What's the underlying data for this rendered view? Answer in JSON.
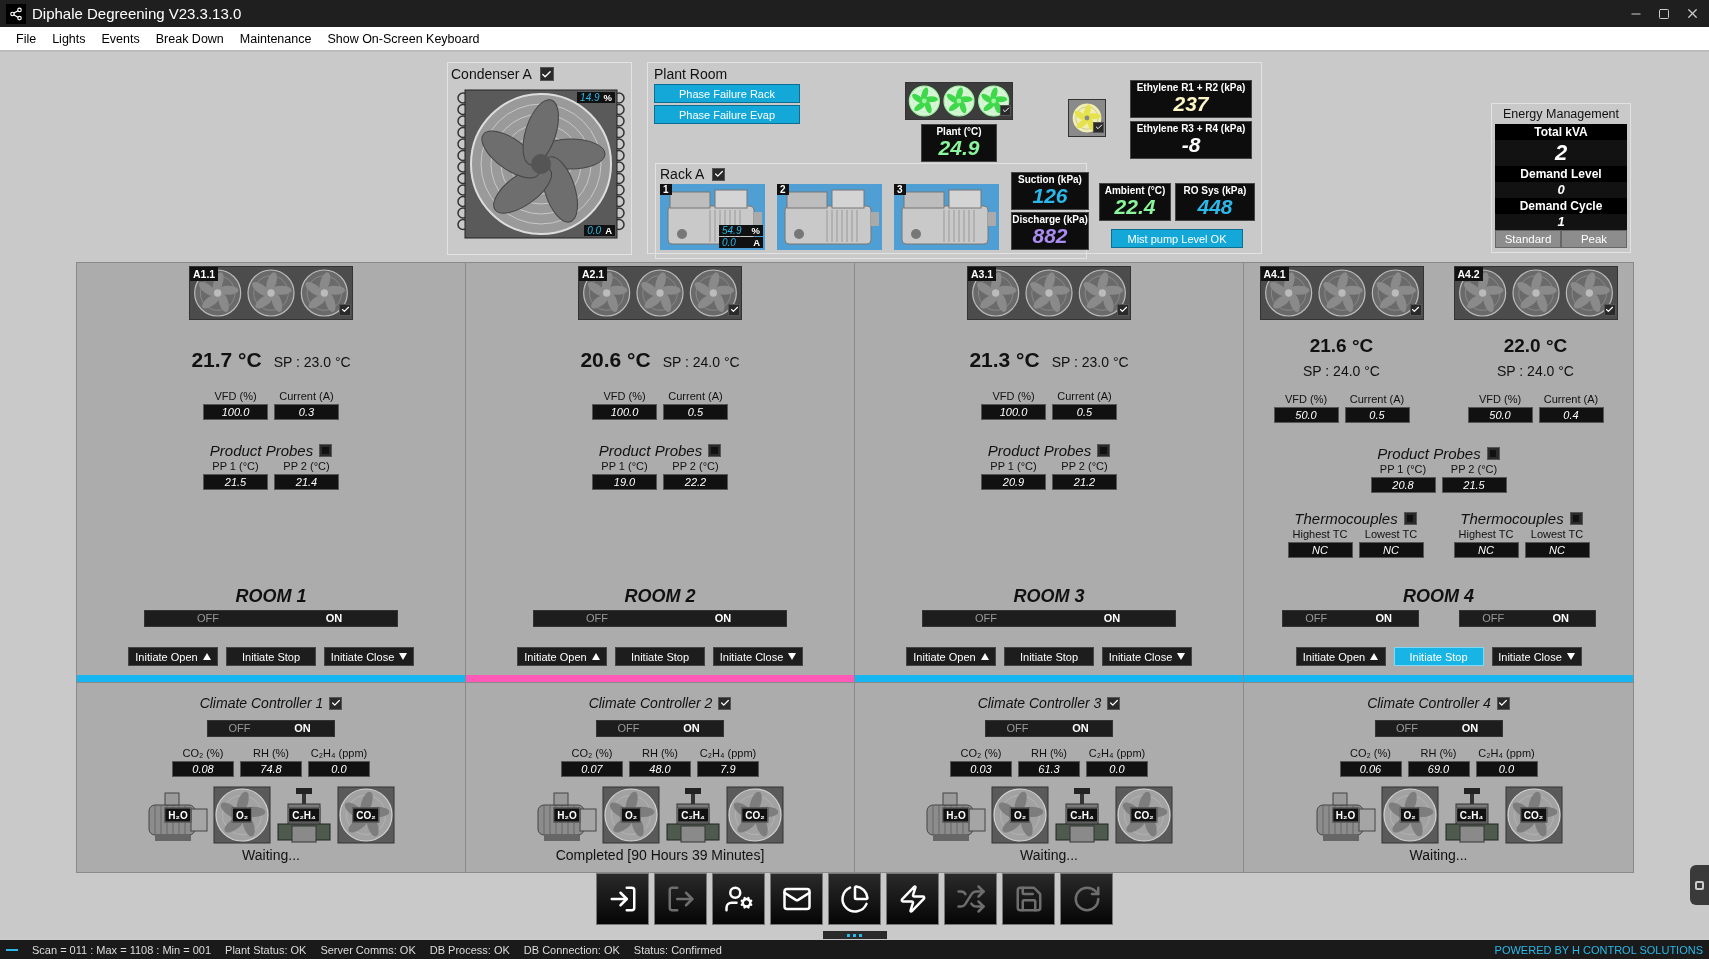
{
  "window": {
    "title": "Diphale Degreening V23.3.13.0"
  },
  "menu": [
    "File",
    "Lights",
    "Events",
    "Break Down",
    "Maintenance",
    "Show On-Screen Keyboard"
  ],
  "condenser": {
    "title": "Condenser A",
    "checked": true,
    "readings": [
      {
        "value": "14.9",
        "unit": "%"
      },
      {
        "value": "0.0",
        "unit": "A"
      }
    ]
  },
  "plant_room": {
    "title": "Plant Room",
    "alarms": [
      "Phase Failure Rack",
      "Phase Failure Evap"
    ],
    "fans_checked": true,
    "plant": {
      "label": "Plant (°C)",
      "value": "24.9",
      "color": "#8af59c"
    },
    "yellow_fan_checked": true,
    "ethylene": [
      {
        "label": "Ethylene R1 + R2 (kPa)",
        "value": "237",
        "color": "#fff6c8"
      },
      {
        "label": "Ethylene R3 + R4 (kPa)",
        "value": "-8",
        "color": "#ffffff"
      }
    ],
    "rack": {
      "title": "Rack A",
      "checked": true,
      "compressors": [
        {
          "number": "1",
          "readings": [
            {
              "value": "54.9",
              "unit": "%"
            },
            {
              "value": "0.0",
              "unit": "A"
            }
          ]
        },
        {
          "number": "2"
        },
        {
          "number": "3"
        }
      ],
      "pressures": [
        {
          "label": "Suction (kPa)",
          "value": "126",
          "color": "#2bb8e8"
        },
        {
          "label": "Discharge (kPa)",
          "value": "882",
          "color": "#a98cf0"
        }
      ]
    },
    "ambient": [
      {
        "label": "Ambient (°C)",
        "value": "22.4",
        "color": "#8af59c"
      },
      {
        "label": "RO Sys (kPa)",
        "value": "448",
        "color": "#2bb8e8"
      }
    ],
    "mist_pump": "Mist pump Level OK"
  },
  "energy": {
    "title": "Energy Management",
    "rows": [
      {
        "label": "Total kVA",
        "value": "2"
      },
      {
        "label": "Demand Level",
        "value": "0"
      },
      {
        "label": "Demand Cycle",
        "value": "1"
      }
    ],
    "modes": [
      "Standard",
      "Peak"
    ]
  },
  "rooms": [
    {
      "name": "ROOM 1",
      "color": "#16b6f0",
      "evaporators": [
        {
          "tag": "A1.1",
          "checked": true,
          "temp": "21.7 °C",
          "sp": "SP : 23.0 °C",
          "readings": [
            {
              "label": "VFD (%)",
              "value": "100.0"
            },
            {
              "label": "Current (A)",
              "value": "0.3"
            }
          ]
        }
      ],
      "probes": {
        "label": "Product Probes",
        "checked": false,
        "readings": [
          {
            "label": "PP 1 (°C)",
            "value": "21.5"
          },
          {
            "label": "PP 2 (°C)",
            "value": "21.4"
          }
        ]
      },
      "switches": [
        {
          "off": "OFF",
          "on_label": "ON",
          "on": true
        }
      ],
      "buttons": [
        {
          "label": "Initiate Open",
          "kind": "open",
          "selected": false
        },
        {
          "label": "Initiate Stop",
          "kind": "stop",
          "selected": false
        },
        {
          "label": "Initiate Close",
          "kind": "close",
          "selected": false
        }
      ]
    },
    {
      "name": "ROOM 2",
      "color": "#ff5ab8",
      "evaporators": [
        {
          "tag": "A2.1",
          "checked": true,
          "temp": "20.6 °C",
          "sp": "SP : 24.0 °C",
          "readings": [
            {
              "label": "VFD (%)",
              "value": "100.0"
            },
            {
              "label": "Current (A)",
              "value": "0.5"
            }
          ]
        }
      ],
      "probes": {
        "label": "Product Probes",
        "checked": false,
        "readings": [
          {
            "label": "PP 1 (°C)",
            "value": "19.0"
          },
          {
            "label": "PP 2 (°C)",
            "value": "22.2"
          }
        ]
      },
      "switches": [
        {
          "off": "OFF",
          "on_label": "ON",
          "on": true
        }
      ],
      "buttons": [
        {
          "label": "Initiate Open",
          "kind": "open",
          "selected": false
        },
        {
          "label": "Initiate Stop",
          "kind": "stop",
          "selected": false
        },
        {
          "label": "Initiate Close",
          "kind": "close",
          "selected": false
        }
      ]
    },
    {
      "name": "ROOM 3",
      "color": "#16b6f0",
      "evaporators": [
        {
          "tag": "A3.1",
          "checked": true,
          "temp": "21.3 °C",
          "sp": "SP : 23.0 °C",
          "readings": [
            {
              "label": "VFD (%)",
              "value": "100.0"
            },
            {
              "label": "Current (A)",
              "value": "0.5"
            }
          ]
        }
      ],
      "probes": {
        "label": "Product Probes",
        "checked": false,
        "readings": [
          {
            "label": "PP 1 (°C)",
            "value": "20.9"
          },
          {
            "label": "PP 2 (°C)",
            "value": "21.2"
          }
        ]
      },
      "switches": [
        {
          "off": "OFF",
          "on_label": "ON",
          "on": true
        }
      ],
      "buttons": [
        {
          "label": "Initiate Open",
          "kind": "open",
          "selected": false
        },
        {
          "label": "Initiate Stop",
          "kind": "stop",
          "selected": false
        },
        {
          "label": "Initiate Close",
          "kind": "close",
          "selected": false
        }
      ]
    },
    {
      "name": "ROOM 4",
      "color": "#16b6f0",
      "evaporators": [
        {
          "tag": "A4.1",
          "checked": true,
          "temp": "21.6 °C",
          "sp": "SP : 24.0 °C",
          "readings": [
            {
              "label": "VFD (%)",
              "value": "50.0"
            },
            {
              "label": "Current (A)",
              "value": "0.5"
            }
          ]
        },
        {
          "tag": "A4.2",
          "checked": true,
          "temp": "22.0 °C",
          "sp": "SP : 24.0 °C",
          "readings": [
            {
              "label": "VFD (%)",
              "value": "50.0"
            },
            {
              "label": "Current (A)",
              "value": "0.4"
            }
          ]
        }
      ],
      "probes": {
        "label": "Product Probes",
        "checked": false,
        "readings": [
          {
            "label": "PP 1 (°C)",
            "value": "20.8"
          },
          {
            "label": "PP 2 (°C)",
            "value": "21.5"
          }
        ]
      },
      "thermocouples": [
        {
          "label": "Thermocouples",
          "checked": false,
          "readings": [
            {
              "label": "Highest TC",
              "value": "NC"
            },
            {
              "label": "Lowest TC",
              "value": "NC"
            }
          ]
        },
        {
          "label": "Thermocouples",
          "checked": false,
          "readings": [
            {
              "label": "Highest TC",
              "value": "NC"
            },
            {
              "label": "Lowest TC",
              "value": "NC"
            }
          ]
        }
      ],
      "switches": [
        {
          "off": "OFF",
          "on_label": "ON",
          "on": true
        },
        {
          "off": "OFF",
          "on_label": "ON",
          "on": true
        }
      ],
      "buttons": [
        {
          "label": "Initiate Open",
          "kind": "open",
          "selected": false
        },
        {
          "label": "Initiate Stop",
          "kind": "stop",
          "selected": true
        },
        {
          "label": "Initiate Close",
          "kind": "close",
          "selected": false
        }
      ]
    }
  ],
  "climate": [
    {
      "title": "Climate Controller 1",
      "checked": true,
      "switch": {
        "off": "OFF",
        "on_label": "ON",
        "on": true
      },
      "readings": [
        {
          "label": "CO₂ (%)",
          "value": "0.08"
        },
        {
          "label": "RH (%)",
          "value": "74.8"
        },
        {
          "label": "C₂H₄ (ppm)",
          "value": "0.0"
        }
      ],
      "devices": [
        {
          "kind": "pump",
          "label": "H₂O"
        },
        {
          "kind": "fan",
          "label": "O₂"
        },
        {
          "kind": "valve",
          "label": "C₂H₄"
        },
        {
          "kind": "fan",
          "label": "CO₂"
        }
      ],
      "status": "Waiting..."
    },
    {
      "title": "Climate Controller 2",
      "checked": true,
      "switch": {
        "off": "OFF",
        "on_label": "ON",
        "on": true
      },
      "readings": [
        {
          "label": "CO₂ (%)",
          "value": "0.07"
        },
        {
          "label": "RH (%)",
          "value": "48.0"
        },
        {
          "label": "C₂H₄ (ppm)",
          "value": "7.9"
        }
      ],
      "devices": [
        {
          "kind": "pump",
          "label": "H₂O"
        },
        {
          "kind": "fan",
          "label": "O₂"
        },
        {
          "kind": "valve",
          "label": "C₂H₄"
        },
        {
          "kind": "fan",
          "label": "CO₂"
        }
      ],
      "status": "Completed [90 Hours 39 Minutes]"
    },
    {
      "title": "Climate Controller 3",
      "checked": true,
      "switch": {
        "off": "OFF",
        "on_label": "ON",
        "on": true
      },
      "readings": [
        {
          "label": "CO₂ (%)",
          "value": "0.03"
        },
        {
          "label": "RH (%)",
          "value": "61.3"
        },
        {
          "label": "C₂H₄ (ppm)",
          "value": "0.0"
        }
      ],
      "devices": [
        {
          "kind": "pump",
          "label": "H₂O"
        },
        {
          "kind": "fan",
          "label": "O₂"
        },
        {
          "kind": "valve",
          "label": "C₂H₄"
        },
        {
          "kind": "fan",
          "label": "CO₂"
        }
      ],
      "status": "Waiting..."
    },
    {
      "title": "Climate Controller 4",
      "checked": true,
      "switch": {
        "off": "OFF",
        "on_label": "ON",
        "on": true
      },
      "readings": [
        {
          "label": "CO₂ (%)",
          "value": "0.06"
        },
        {
          "label": "RH (%)",
          "value": "69.0"
        },
        {
          "label": "C₂H₄ (ppm)",
          "value": "0.0"
        }
      ],
      "devices": [
        {
          "kind": "pump",
          "label": "H₂O"
        },
        {
          "kind": "fan",
          "label": "O₂"
        },
        {
          "kind": "valve",
          "label": "C₂H₄"
        },
        {
          "kind": "fan",
          "label": "CO₂"
        }
      ],
      "status": "Waiting..."
    }
  ],
  "toolbar": [
    {
      "kind": "login",
      "disabled": false
    },
    {
      "kind": "logout",
      "disabled": true
    },
    {
      "kind": "user-settings",
      "disabled": false
    },
    {
      "kind": "mail",
      "disabled": false
    },
    {
      "kind": "chart",
      "disabled": false
    },
    {
      "kind": "power",
      "disabled": false
    },
    {
      "kind": "shuffle",
      "disabled": true
    },
    {
      "kind": "save",
      "disabled": true
    },
    {
      "kind": "refresh",
      "disabled": true
    }
  ],
  "status_bar": {
    "items": [
      "Scan = 011 : Max = 1108 : Min = 001",
      "Plant Status: OK",
      "Server Comms: OK",
      "DB Process: OK",
      "DB Connection: OK",
      "Status: Confirmed"
    ],
    "credit": "POWERED BY H CONTROL SOLUTIONS"
  }
}
